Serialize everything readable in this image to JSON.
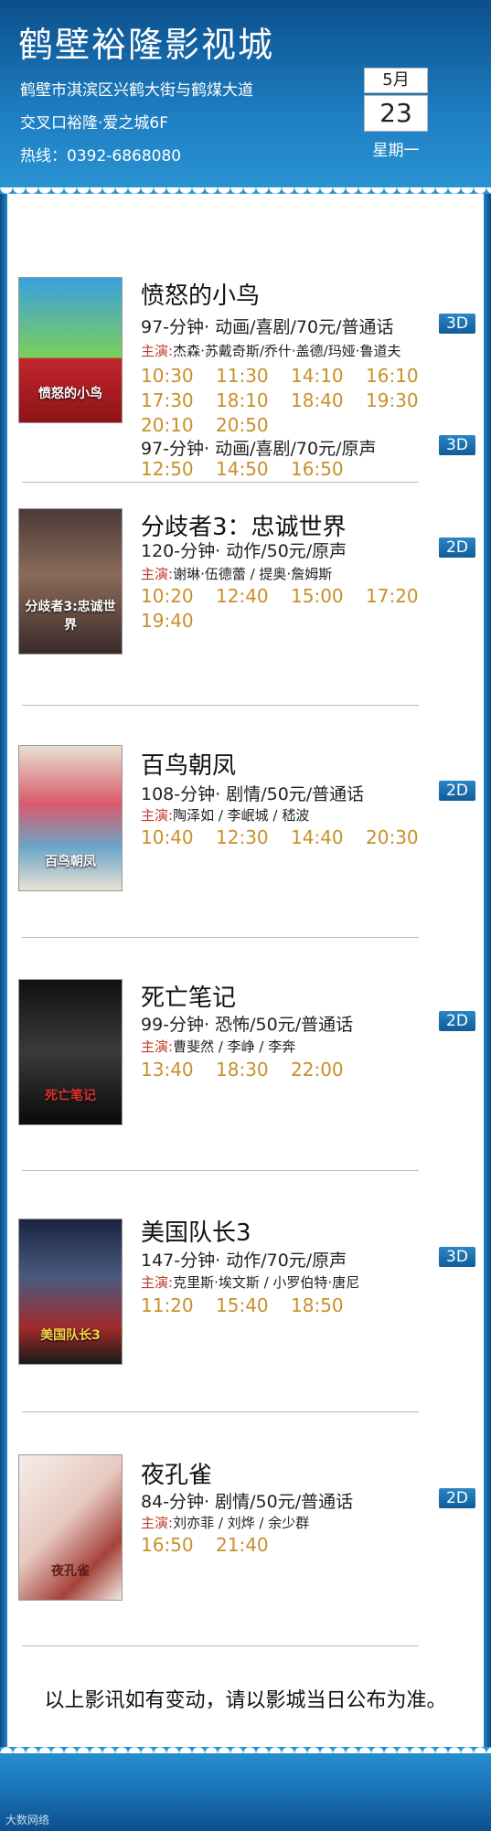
{
  "header": {
    "cinema_name": "鹤壁裕隆影视城",
    "address_line1": "鹤壁市淇滨区兴鹤大街与鹤煤大道",
    "address_line2": "交叉口裕隆·爱之城6F",
    "hotline": "热线：0392-6868080",
    "date": {
      "month": "5月",
      "day": "23",
      "weekday": "星期一"
    }
  },
  "cast_label": "主演:",
  "movies": [
    {
      "title": "愤怒的小鸟",
      "poster_text": "愤怒的小鸟",
      "cast": "杰森·苏戴奇斯/乔什·盖德/玛娅·鲁道夫",
      "versions": [
        {
          "info": "97-分钟· 动画/喜剧/70元/普通话",
          "format": "3D",
          "times": [
            "10:30",
            "11:30",
            "14:10",
            "16:10",
            "17:30",
            "18:10",
            "18:40",
            "19:30",
            "20:10",
            "20:50"
          ]
        },
        {
          "info": "97-分钟· 动画/喜剧/70元/原声",
          "format": "3D",
          "times": [
            "12:50",
            "14:50",
            "16:50"
          ]
        }
      ]
    },
    {
      "title": "分歧者3：忠诚世界",
      "poster_text": "分歧者3:忠诚世界",
      "cast": "谢琳·伍德蕾 / 提奥·詹姆斯",
      "versions": [
        {
          "info": "120-分钟· 动作/50元/原声",
          "format": "2D",
          "times": [
            "10:20",
            "12:40",
            "15:00",
            "17:20",
            "19:40"
          ]
        }
      ]
    },
    {
      "title": "百鸟朝凤",
      "poster_text": "百鸟朝凤",
      "cast": "陶泽如 / 李岷城 / 嵇波",
      "versions": [
        {
          "info": "108-分钟· 剧情/50元/普通话",
          "format": "2D",
          "times": [
            "10:40",
            "12:30",
            "14:40",
            "20:30"
          ]
        }
      ]
    },
    {
      "title": "死亡笔记",
      "poster_text": "死亡笔记",
      "cast": "曹斐然 / 李峥 / 李奔",
      "versions": [
        {
          "info": "99-分钟· 恐怖/50元/普通话",
          "format": "2D",
          "times": [
            "13:40",
            "18:30",
            "22:00"
          ]
        }
      ]
    },
    {
      "title": "美国队长3",
      "poster_text": "美国队长3",
      "cast": "克里斯·埃文斯 / 小罗伯特·唐尼",
      "versions": [
        {
          "info": "147-分钟· 动作/70元/原声",
          "format": "3D",
          "times": [
            "11:20",
            "15:40",
            "18:50"
          ]
        }
      ]
    },
    {
      "title": "夜孔雀",
      "poster_text": "夜孔雀",
      "cast": "刘亦菲 / 刘烨 / 余少群",
      "versions": [
        {
          "info": "84-分钟· 剧情/50元/普通话",
          "format": "2D",
          "times": [
            "16:50",
            "21:40"
          ]
        }
      ]
    }
  ],
  "notice": "以上影讯如有变动，请以影城当日公布为准。",
  "watermark": "大数网络"
}
